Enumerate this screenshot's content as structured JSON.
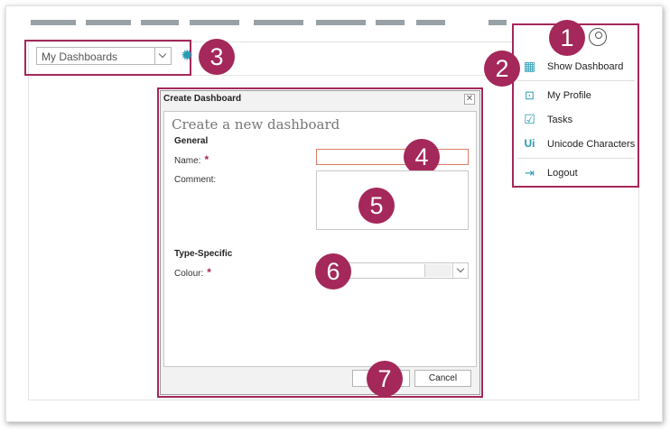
{
  "toolbar": {
    "dashboard_select_value": "My Dashboards"
  },
  "user_menu": {
    "items": [
      {
        "label": "Show Dashboard",
        "icon": "grid-icon"
      },
      {
        "label": "My Profile",
        "icon": "profile-card-icon"
      },
      {
        "label": "Tasks",
        "icon": "checkbox-icon"
      },
      {
        "label": "Unicode Characters",
        "icon": "unicode-icon"
      },
      {
        "label": "Logout",
        "icon": "logout-icon"
      }
    ]
  },
  "dialog": {
    "title": "Create Dashboard",
    "close_glyph": "✕",
    "heading": "Create a new dashboard",
    "general_label": "General",
    "name_label": "Name:",
    "comment_label": "Comment:",
    "type_specific_label": "Type-Specific",
    "colour_label": "Colour:",
    "required_mark": "*",
    "cancel_label": "Cancel"
  },
  "callouts": [
    "1",
    "2",
    "3",
    "4",
    "5",
    "6",
    "7"
  ],
  "colors": {
    "accent": "#a4285a",
    "icon_teal": "#2a9bb5",
    "nav_gray": "#97a1a6",
    "error_border": "#e07b68"
  }
}
